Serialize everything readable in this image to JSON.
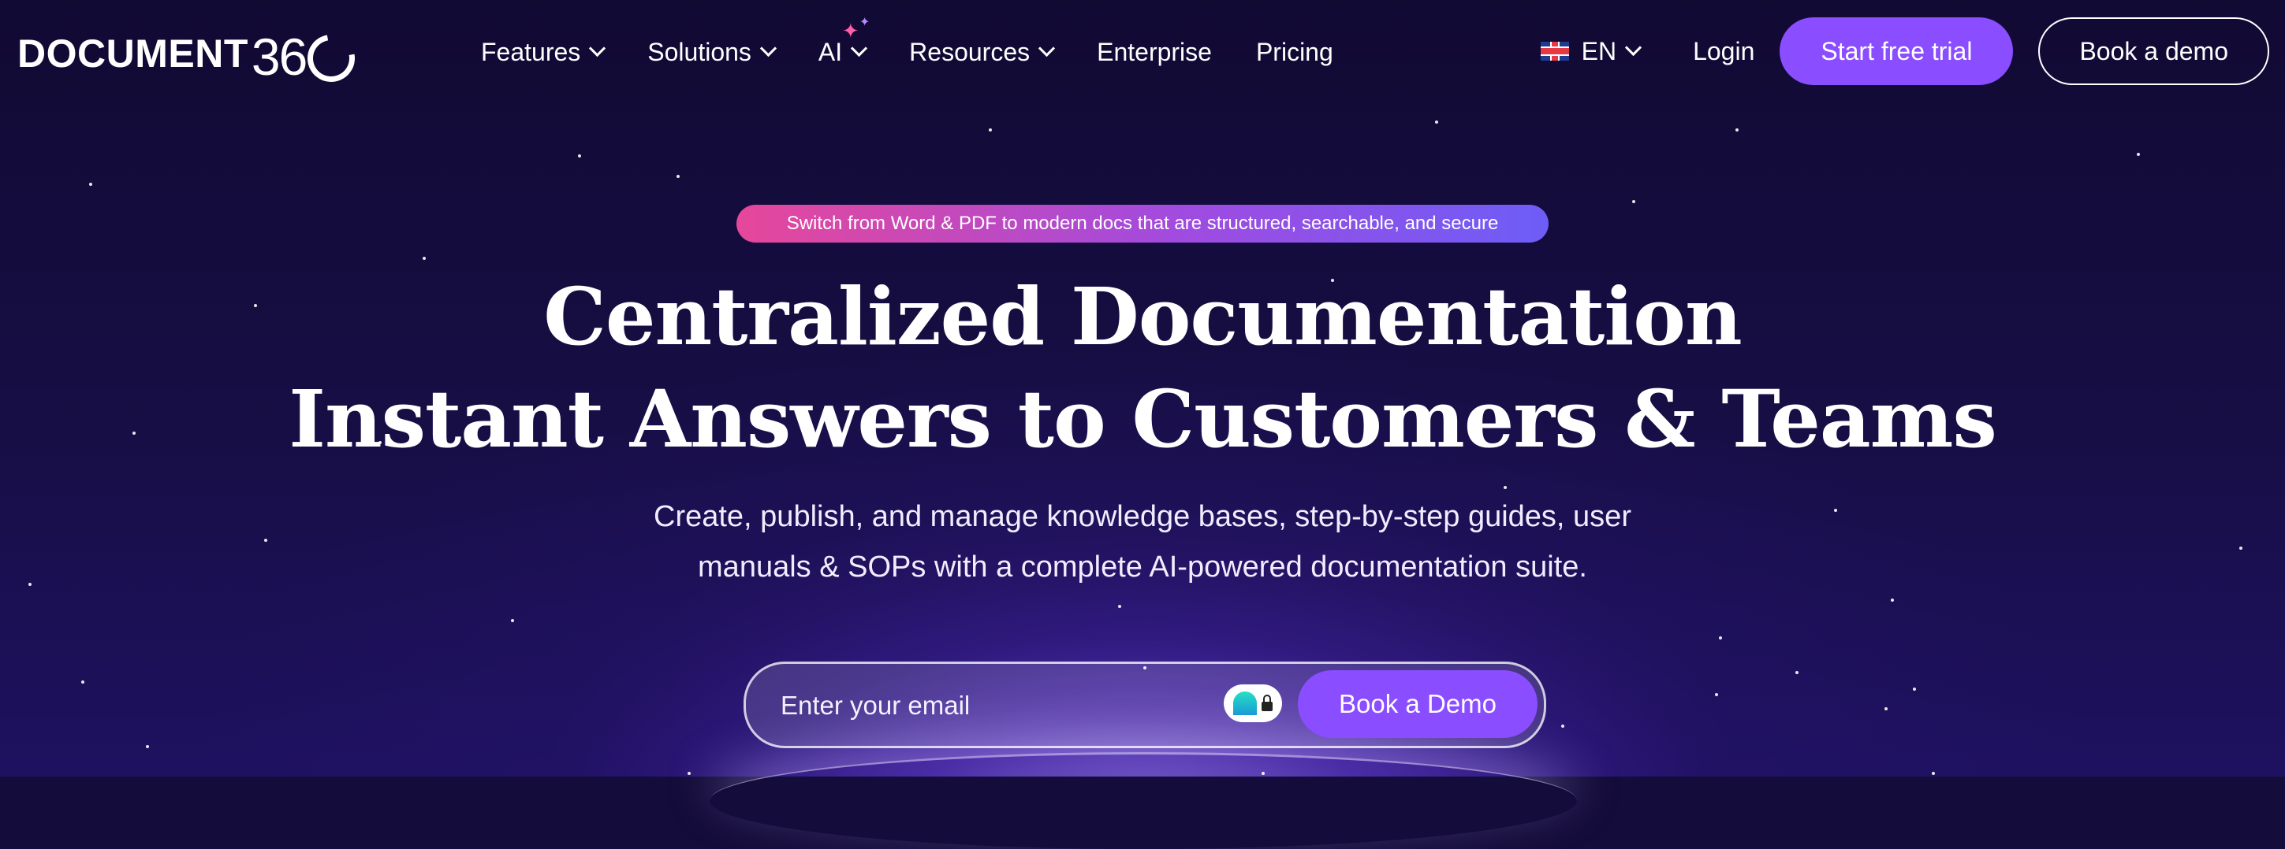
{
  "logo": {
    "word": "DOCUMENT",
    "number": "36"
  },
  "nav": {
    "items": [
      {
        "label": "Features",
        "dropdown": true
      },
      {
        "label": "Solutions",
        "dropdown": true
      },
      {
        "label": "AI",
        "dropdown": true
      },
      {
        "label": "Resources",
        "dropdown": true
      },
      {
        "label": "Enterprise",
        "dropdown": false
      },
      {
        "label": "Pricing",
        "dropdown": false
      }
    ],
    "language": "EN",
    "login": "Login",
    "start_trial": "Start free trial",
    "book_demo": "Book a demo"
  },
  "hero": {
    "pill": "Switch from Word & PDF to modern docs that are structured, searchable, and secure",
    "title_line1": "Centralized Documentation",
    "title_line2": "Instant Answers to Customers & Teams",
    "subtitle_line1": "Create, publish, and manage knowledge bases, step-by-step guides, user",
    "subtitle_line2": "manuals & SOPs with a complete AI-powered documentation suite.",
    "email_placeholder": "Enter your email",
    "cta": "Book a Demo"
  },
  "colors": {
    "background": "#140c3a",
    "accent": "#8a4dff",
    "pill_start": "#e6479a",
    "pill_end": "#6d5df7"
  }
}
